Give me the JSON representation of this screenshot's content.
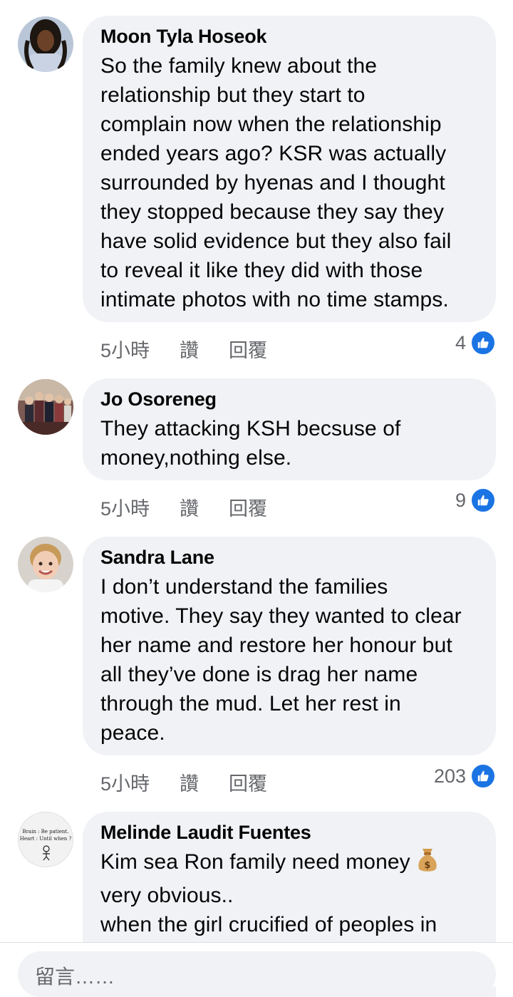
{
  "comments": [
    {
      "author": "Moon Tyla Hoseok",
      "text": "So the family knew about the\nrelationship but they start to\ncomplain now when the relationship\nended years ago? KSR was actually\nsurrounded by hyenas and I thought\nthey stopped because they say they\nhave solid evidence but they also fail\nto reveal it like they did with those\nintimate photos with no time stamps.",
      "time": "5小時",
      "like_label": "讚",
      "reply_label": "回覆",
      "like_count": "4"
    },
    {
      "author": "Jo Osoreneg",
      "text": "They attacking KSH becsuse of\nmoney,nothing else.",
      "time": "5小時",
      "like_label": "讚",
      "reply_label": "回覆",
      "like_count": "9"
    },
    {
      "author": "Sandra Lane",
      "text": "I don’t understand the families\nmotive. They say they wanted to clear\nher name and restore her honour but\nall they’ve done is drag her name\nthrough the mud. Let her rest in\npeace.",
      "time": "5小時",
      "like_label": "讚",
      "reply_label": "回覆",
      "like_count": "203"
    },
    {
      "author": "Melinde Laudit Fuentes",
      "text_line1": "Kim sea Ron family need money",
      "text_rest": "very obvious..\nwhen the girl crucified of peoples in",
      "avatar_text_line1": "Brain : Be patient.",
      "avatar_text_line2": "Heart : Until when ?"
    }
  ],
  "composer": {
    "placeholder": "留言……"
  },
  "colors": {
    "like_blue": "#1b74e4",
    "bubble": "#f0f2f5",
    "meta": "#65676b"
  }
}
